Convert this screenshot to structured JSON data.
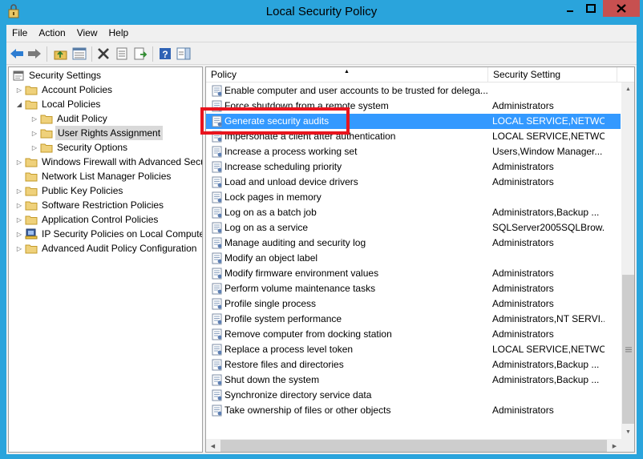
{
  "window": {
    "title": "Local Security Policy",
    "titlebar_color": "#2aa4dc",
    "close_color": "#c75050",
    "selection_color": "#3399ff",
    "annotation_color": "#e8141e"
  },
  "menu": [
    "File",
    "Action",
    "View",
    "Help"
  ],
  "toolbar": {
    "buttons": [
      "back-icon",
      "forward-icon",
      "up-folder-icon",
      "show-hide-tree-icon",
      "delete-icon",
      "properties-icon",
      "export-list-icon",
      "help-icon",
      "show-hide-action-pane-icon"
    ]
  },
  "tree": {
    "root": "Security Settings",
    "items": [
      {
        "label": "Account Policies"
      },
      {
        "label": "Local Policies"
      },
      {
        "label": "Audit Policy"
      },
      {
        "label": "User Rights Assignment"
      },
      {
        "label": "Security Options"
      },
      {
        "label": "Windows Firewall with Advanced Secu"
      },
      {
        "label": "Network List Manager Policies"
      },
      {
        "label": "Public Key Policies"
      },
      {
        "label": "Software Restriction Policies"
      },
      {
        "label": "Application Control Policies"
      },
      {
        "label": "IP Security Policies on Local Compute"
      },
      {
        "label": "Advanced Audit Policy Configuration"
      }
    ],
    "selected": "User Rights Assignment"
  },
  "list": {
    "columns": [
      "Policy",
      "Security Setting"
    ],
    "rows": [
      {
        "policy": "Enable computer and user accounts to be trusted for delega...",
        "setting": ""
      },
      {
        "policy": "Force shutdown from a remote system",
        "setting": "Administrators"
      },
      {
        "policy": "Generate security audits",
        "setting": "LOCAL SERVICE,NETWO..."
      },
      {
        "policy": "Impersonate a client after authentication",
        "setting": "LOCAL SERVICE,NETWO..."
      },
      {
        "policy": "Increase a process working set",
        "setting": "Users,Window Manager..."
      },
      {
        "policy": "Increase scheduling priority",
        "setting": "Administrators"
      },
      {
        "policy": "Load and unload device drivers",
        "setting": "Administrators"
      },
      {
        "policy": "Lock pages in memory",
        "setting": ""
      },
      {
        "policy": "Log on as a batch job",
        "setting": "Administrators,Backup ..."
      },
      {
        "policy": "Log on as a service",
        "setting": "SQLServer2005SQLBrow..."
      },
      {
        "policy": "Manage auditing and security log",
        "setting": "Administrators"
      },
      {
        "policy": "Modify an object label",
        "setting": ""
      },
      {
        "policy": "Modify firmware environment values",
        "setting": "Administrators"
      },
      {
        "policy": "Perform volume maintenance tasks",
        "setting": "Administrators"
      },
      {
        "policy": "Profile single process",
        "setting": "Administrators"
      },
      {
        "policy": "Profile system performance",
        "setting": "Administrators,NT SERVI..."
      },
      {
        "policy": "Remove computer from docking station",
        "setting": "Administrators"
      },
      {
        "policy": "Replace a process level token",
        "setting": "LOCAL SERVICE,NETWO..."
      },
      {
        "policy": "Restore files and directories",
        "setting": "Administrators,Backup ..."
      },
      {
        "policy": "Shut down the system",
        "setting": "Administrators,Backup ..."
      },
      {
        "policy": "Synchronize directory service data",
        "setting": ""
      },
      {
        "policy": "Take ownership of files or other objects",
        "setting": "Administrators"
      }
    ],
    "selected_index": 2
  }
}
